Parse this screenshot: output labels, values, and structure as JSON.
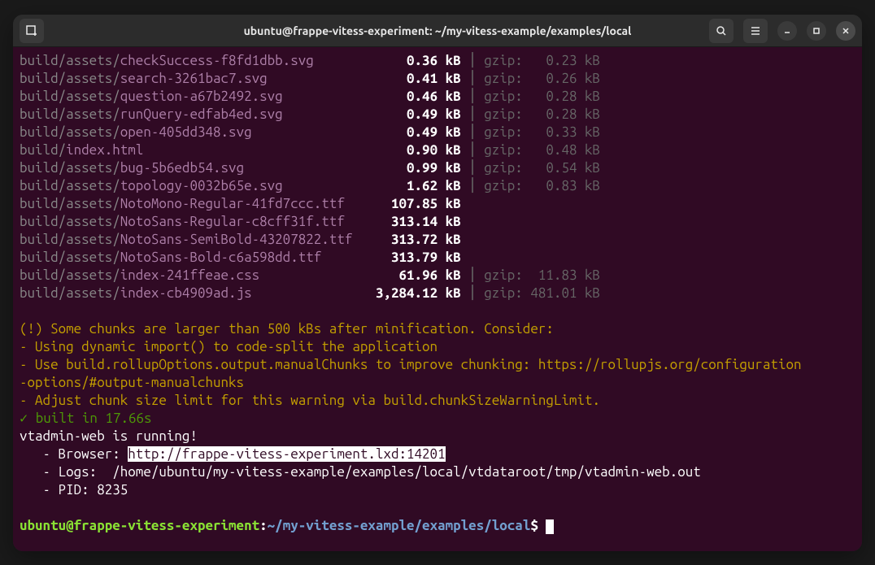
{
  "titlebar": {
    "title": "ubuntu@frappe-vitess-experiment: ~/my-vitess-example/examples/local"
  },
  "rows": [
    {
      "path": "build/assets/",
      "file": "checkSuccess-f8fd1dbb.svg",
      "size": "0.36 kB",
      "gzip": "0.23 kB"
    },
    {
      "path": "build/assets/",
      "file": "search-3261bac7.svg",
      "size": "0.41 kB",
      "gzip": "0.26 kB"
    },
    {
      "path": "build/assets/",
      "file": "question-a67b2492.svg",
      "size": "0.46 kB",
      "gzip": "0.28 kB"
    },
    {
      "path": "build/assets/",
      "file": "runQuery-edfab4ed.svg",
      "size": "0.49 kB",
      "gzip": "0.28 kB"
    },
    {
      "path": "build/assets/",
      "file": "open-405dd348.svg",
      "size": "0.49 kB",
      "gzip": "0.33 kB"
    },
    {
      "path": "build/",
      "file": "index.html",
      "size": "0.90 kB",
      "gzip": "0.48 kB"
    },
    {
      "path": "build/assets/",
      "file": "bug-5b6edb54.svg",
      "size": "0.99 kB",
      "gzip": "0.54 kB"
    },
    {
      "path": "build/assets/",
      "file": "topology-0032b65e.svg",
      "size": "1.62 kB",
      "gzip": "0.83 kB"
    },
    {
      "path": "build/assets/",
      "file": "NotoMono-Regular-41fd7ccc.ttf",
      "size": "107.85 kB",
      "gzip": ""
    },
    {
      "path": "build/assets/",
      "file": "NotoSans-Regular-c8cff31f.ttf",
      "size": "313.14 kB",
      "gzip": ""
    },
    {
      "path": "build/assets/",
      "file": "NotoSans-SemiBold-43207822.ttf",
      "size": "313.72 kB",
      "gzip": ""
    },
    {
      "path": "build/assets/",
      "file": "NotoSans-Bold-c6a598dd.ttf",
      "size": "313.79 kB",
      "gzip": ""
    },
    {
      "path": "build/assets/",
      "file": "index-241ffeae.css",
      "size": "61.96 kB",
      "gzip": "11.83 kB"
    },
    {
      "path": "build/assets/",
      "file": "index-cb4909ad.js",
      "size": "3,284.12 kB",
      "gzip": "481.01 kB"
    }
  ],
  "warn": {
    "l1": "(!) Some chunks are larger than 500 kBs after minification. Consider:",
    "l2": "- Using dynamic import() to code-split the application",
    "l3a": "- Use build.rollupOptions.output.manualChunks to improve chunking: https://rollupjs.org/configuration",
    "l3b": "-options/#output-manualchunks",
    "l4": "- Adjust chunk size limit for this warning via build.chunkSizeWarningLimit."
  },
  "built": {
    "check": "✓",
    "text": " built in 17.66s"
  },
  "run": {
    "running": "vtadmin-web is running!",
    "browser_lbl": "   - Browser: ",
    "browser_url": "http://frappe-vitess-experiment.lxd:14201",
    "logs": "   - Logs:  /home/ubuntu/my-vitess-example/examples/local/vtdataroot/tmp/vtadmin-web.out",
    "pid": "   - PID: 8235"
  },
  "prompt": {
    "user": "ubuntu@frappe-vitess-experiment",
    "colon": ":",
    "path": "~/my-vitess-example/examples/local",
    "dollar": "$ "
  }
}
